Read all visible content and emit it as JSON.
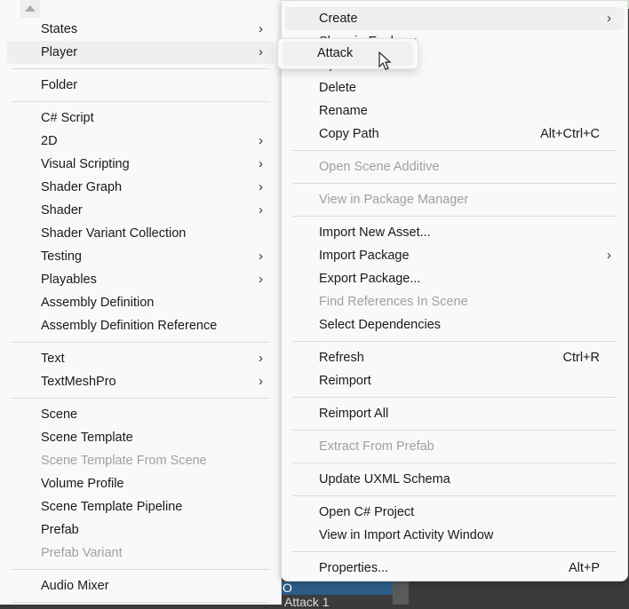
{
  "left_menu": {
    "scroll_up_icon": "triangle-up-icon",
    "groups": [
      [
        {
          "label": "States",
          "submenu": true
        },
        {
          "label": "Player",
          "submenu": true,
          "highlighted": true
        }
      ],
      [
        {
          "label": "Folder"
        }
      ],
      [
        {
          "label": "C# Script"
        },
        {
          "label": "2D",
          "submenu": true
        },
        {
          "label": "Visual Scripting",
          "submenu": true
        },
        {
          "label": "Shader Graph",
          "submenu": true
        },
        {
          "label": "Shader",
          "submenu": true
        },
        {
          "label": "Shader Variant Collection"
        },
        {
          "label": "Testing",
          "submenu": true
        },
        {
          "label": "Playables",
          "submenu": true
        },
        {
          "label": "Assembly Definition"
        },
        {
          "label": "Assembly Definition Reference"
        }
      ],
      [
        {
          "label": "Text",
          "submenu": true
        },
        {
          "label": "TextMeshPro",
          "submenu": true
        }
      ],
      [
        {
          "label": "Scene"
        },
        {
          "label": "Scene Template"
        },
        {
          "label": "Scene Template From Scene",
          "disabled": true
        },
        {
          "label": "Volume Profile"
        },
        {
          "label": "Scene Template Pipeline"
        },
        {
          "label": "Prefab"
        },
        {
          "label": "Prefab Variant",
          "disabled": true
        }
      ],
      [
        {
          "label": "Audio Mixer"
        }
      ],
      []
    ]
  },
  "right_menu": {
    "groups": [
      [
        {
          "label": "Create",
          "submenu": true,
          "highlighted": true
        },
        {
          "label": "Show in Explorer"
        },
        {
          "label": "Open"
        },
        {
          "label": "Delete"
        },
        {
          "label": "Rename"
        },
        {
          "label": "Copy Path",
          "shortcut": "Alt+Ctrl+C"
        }
      ],
      [
        {
          "label": "Open Scene Additive",
          "disabled": true
        }
      ],
      [
        {
          "label": "View in Package Manager",
          "disabled": true
        }
      ],
      [
        {
          "label": "Import New Asset..."
        },
        {
          "label": "Import Package",
          "submenu": true
        },
        {
          "label": "Export Package..."
        },
        {
          "label": "Find References In Scene",
          "disabled": true
        },
        {
          "label": "Select Dependencies"
        }
      ],
      [
        {
          "label": "Refresh",
          "shortcut": "Ctrl+R"
        },
        {
          "label": "Reimport"
        }
      ],
      [
        {
          "label": "Reimport All"
        }
      ],
      [
        {
          "label": "Extract From Prefab",
          "disabled": true
        }
      ],
      [
        {
          "label": "Update UXML Schema"
        }
      ],
      [
        {
          "label": "Open C# Project"
        },
        {
          "label": "View in Import Activity Window"
        }
      ],
      [
        {
          "label": "Properties...",
          "shortcut": "Alt+P"
        }
      ]
    ]
  },
  "submenu": {
    "items": [
      {
        "label": "Attack",
        "highlighted": true
      }
    ]
  },
  "background": {
    "selected_row": "O",
    "row": "Attack 1"
  },
  "colors": {
    "menu_bg": "#f9f9f9",
    "highlight": "#efefef",
    "disabled_text": "#a0a0a0",
    "selection_blue": "#2c5d87"
  }
}
